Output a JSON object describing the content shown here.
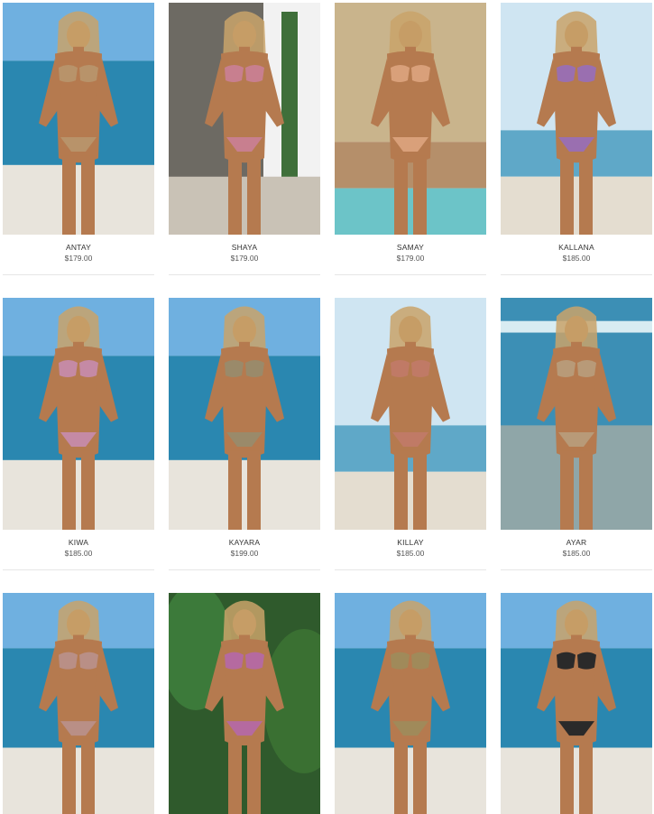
{
  "products": [
    {
      "name": "ANTAY",
      "price": "$179.00",
      "scene": "beach",
      "swim": "#b8936a"
    },
    {
      "name": "SHAYA",
      "price": "$179.00",
      "scene": "villa",
      "swim": "#c87f8f"
    },
    {
      "name": "SAMAY",
      "price": "$179.00",
      "scene": "pool",
      "swim": "#d9a07a"
    },
    {
      "name": "KALLANA",
      "price": "$185.00",
      "scene": "sky",
      "swim": "#9a6fb0"
    },
    {
      "name": "KIWA",
      "price": "$185.00",
      "scene": "beach",
      "swim": "#c58aa5"
    },
    {
      "name": "KAYARA",
      "price": "$199.00",
      "scene": "beach",
      "swim": "#9a8a6a"
    },
    {
      "name": "KILLAY",
      "price": "$185.00",
      "scene": "sky",
      "swim": "#c07a66"
    },
    {
      "name": "AYAR",
      "price": "$185.00",
      "scene": "ocean",
      "swim": "#b89a78"
    },
    {
      "name": "",
      "price": "",
      "scene": "beach",
      "swim": "#b98f86"
    },
    {
      "name": "",
      "price": "",
      "scene": "jungle",
      "swim": "#b56aa0"
    },
    {
      "name": "",
      "price": "",
      "scene": "beach",
      "swim": "#a08a5a"
    },
    {
      "name": "",
      "price": "",
      "scene": "beach",
      "swim": "#2a2a2a"
    }
  ]
}
